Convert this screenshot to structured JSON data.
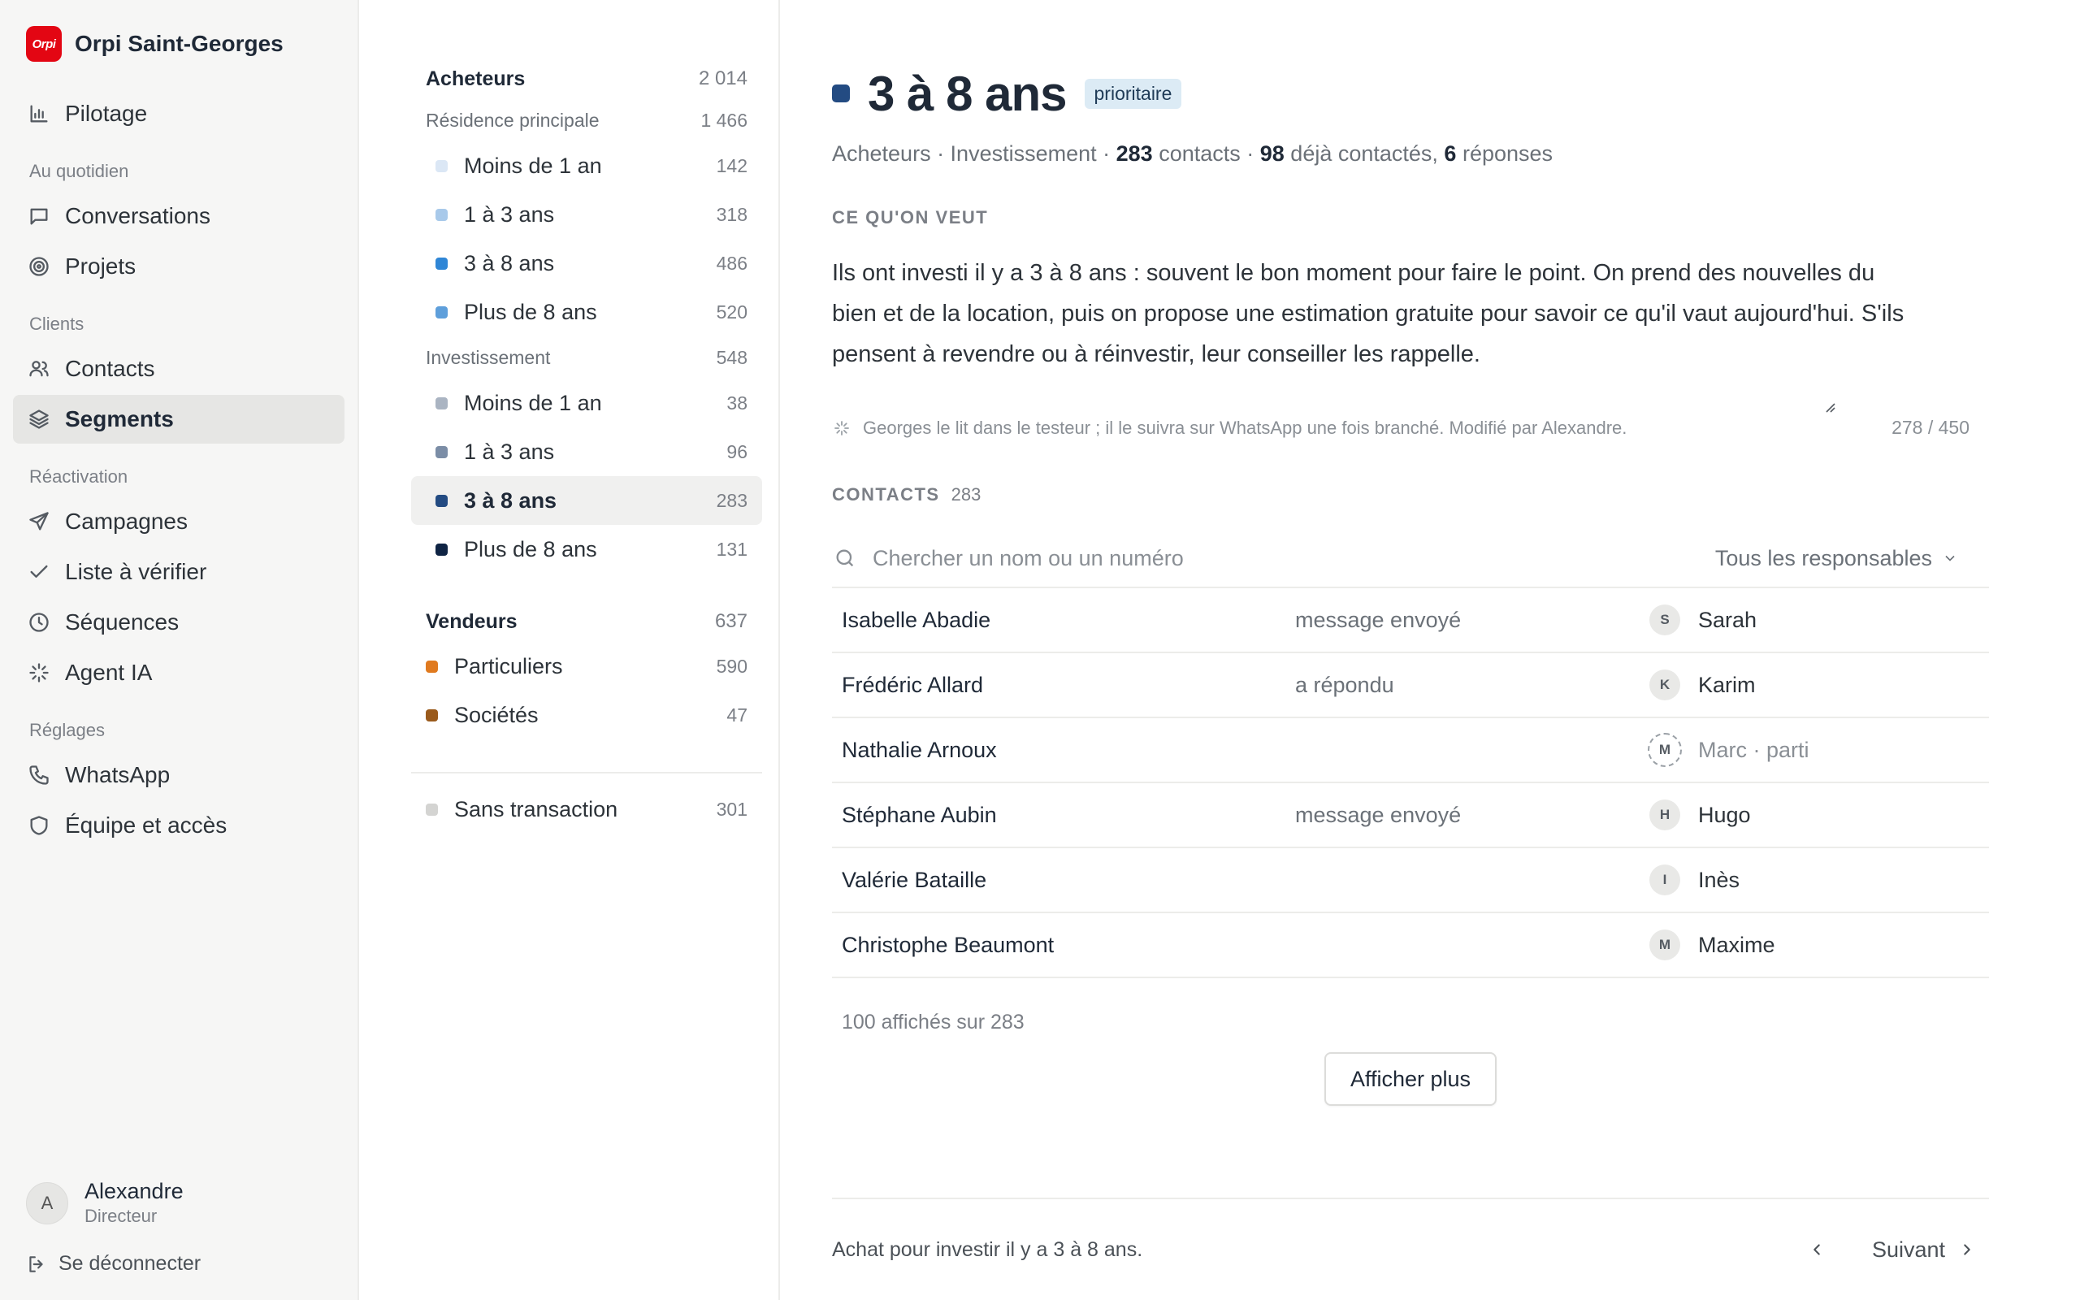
{
  "sidebar": {
    "brand": {
      "logo_text": "Orpi",
      "name": "Orpi Saint-Georges",
      "logo_color": "#e30613"
    },
    "items": [
      {
        "label": "Pilotage",
        "icon": "bar-chart-icon"
      },
      {
        "section": "Au quotidien"
      },
      {
        "label": "Conversations",
        "icon": "chat-icon"
      },
      {
        "label": "Projets",
        "icon": "target-icon"
      },
      {
        "section": "Clients"
      },
      {
        "label": "Contacts",
        "icon": "users-icon"
      },
      {
        "label": "Segments",
        "icon": "layers-icon",
        "active": true
      },
      {
        "section": "Réactivation"
      },
      {
        "label": "Campagnes",
        "icon": "send-icon"
      },
      {
        "label": "Liste à vérifier",
        "icon": "check-icon"
      },
      {
        "label": "Séquences",
        "icon": "clock-icon"
      },
      {
        "label": "Agent IA",
        "icon": "sparkle-icon"
      },
      {
        "section": "Réglages"
      },
      {
        "label": "WhatsApp",
        "icon": "phone-icon"
      },
      {
        "label": "Équipe et accès",
        "icon": "shield-icon"
      }
    ],
    "user": {
      "initial": "A",
      "name": "Alexandre",
      "role": "Directeur"
    },
    "logout_label": "Se déconnecter"
  },
  "segments": {
    "buyers": {
      "label": "Acheteurs",
      "count": "2 014",
      "primary": {
        "label": "Résidence principale",
        "count": "1 466",
        "items": [
          {
            "label": "Moins de 1 an",
            "count": "142",
            "color": "#dbe7f5"
          },
          {
            "label": "1 à 3 ans",
            "count": "318",
            "color": "#a8c9ea"
          },
          {
            "label": "3 à 8 ans",
            "count": "486",
            "color": "#2f86d6"
          },
          {
            "label": "Plus de 8 ans",
            "count": "520",
            "color": "#5e9fdb"
          }
        ]
      },
      "investment": {
        "label": "Investissement",
        "count": "548",
        "items": [
          {
            "label": "Moins de 1 an",
            "count": "38",
            "color": "#aab4c2"
          },
          {
            "label": "1 à 3 ans",
            "count": "96",
            "color": "#7b8da6"
          },
          {
            "label": "3 à 8 ans",
            "count": "283",
            "color": "#234b82",
            "active": true
          },
          {
            "label": "Plus de 8 ans",
            "count": "131",
            "color": "#0f2444"
          }
        ]
      }
    },
    "sellers": {
      "label": "Vendeurs",
      "count": "637",
      "items": [
        {
          "label": "Particuliers",
          "count": "590",
          "color": "#e07a1f"
        },
        {
          "label": "Sociétés",
          "count": "47",
          "color": "#9a5a1c"
        }
      ]
    },
    "no_transaction": {
      "label": "Sans transaction",
      "count": "301",
      "color": "#d4d4d2"
    }
  },
  "main": {
    "title": "3 à 8 ans",
    "title_color": "#234b82",
    "badge": "prioritaire",
    "meta": {
      "path": "Acheteurs · Investissement · ",
      "contacts_num": "283",
      "contacts_txt": " contacts · ",
      "contacted_num": "98",
      "contacted_txt": " déjà contactés, ",
      "replies_num": "6",
      "replies_txt": " réponses"
    },
    "want_label": "CE QU'ON VEUT",
    "description": "Ils ont investi il y a 3 à 8 ans : souvent le bon moment pour faire le point. On prend des nouvelles du bien et de la location, puis on propose une estimation gratuite pour savoir ce qu'il vaut aujourd'hui. S'ils pensent à revendre ou à réinvestir, leur conseiller les rappelle.",
    "note": "Georges le lit dans le testeur ; il le suivra sur WhatsApp une fois branché. Modifié par Alexandre.",
    "char_counter": "278 / 450",
    "contacts_label": "CONTACTS",
    "contacts_count": "283",
    "search_placeholder": "Chercher un nom ou un numéro",
    "owner_filter": "Tous les responsables",
    "rows": [
      {
        "name": "Isabelle Abadie",
        "status": "message envoyé",
        "initial": "S",
        "owner": "Sarah"
      },
      {
        "name": "Frédéric Allard",
        "status": "a répondu",
        "initial": "K",
        "owner": "Karim"
      },
      {
        "name": "Nathalie Arnoux",
        "status": "",
        "initial": "M",
        "owner": "Marc · parti",
        "gone": true
      },
      {
        "name": "Stéphane Aubin",
        "status": "message envoyé",
        "initial": "H",
        "owner": "Hugo"
      },
      {
        "name": "Valérie Bataille",
        "status": "",
        "initial": "I",
        "owner": "Inès"
      },
      {
        "name": "Christophe Beaumont",
        "status": "",
        "initial": "M",
        "owner": "Maxime"
      }
    ],
    "shown_count": "100 affichés sur 283",
    "more_label": "Afficher plus",
    "footer_summary": "Achat pour investir il y a 3 à 8 ans.",
    "next_label": "Suivant"
  }
}
